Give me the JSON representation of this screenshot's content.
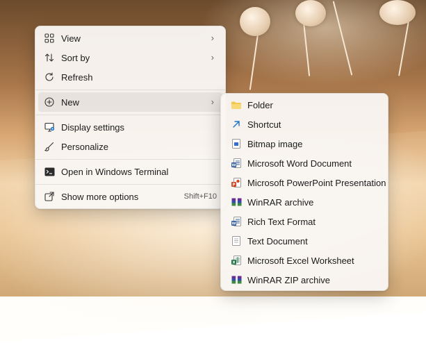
{
  "context_menu": {
    "items": [
      {
        "label": "View",
        "icon": "grid-view-icon"
      },
      {
        "label": "Sort by",
        "icon": "sort-icon"
      },
      {
        "label": "Refresh",
        "icon": "refresh-icon"
      },
      {
        "label": "New",
        "icon": "plus-circle-icon"
      },
      {
        "label": "Display settings",
        "icon": "display-settings-icon"
      },
      {
        "label": "Personalize",
        "icon": "brush-icon"
      },
      {
        "label": "Open in Windows Terminal",
        "icon": "terminal-icon"
      },
      {
        "label": "Show more options",
        "icon": "show-more-icon",
        "shortcut": "Shift+F10"
      }
    ],
    "submenu_chevron": "›"
  },
  "new_submenu": {
    "items": [
      {
        "label": "Folder",
        "icon": "folder-icon"
      },
      {
        "label": "Shortcut",
        "icon": "shortcut-arrow-icon"
      },
      {
        "label": "Bitmap image",
        "icon": "bitmap-icon"
      },
      {
        "label": "Microsoft Word Document",
        "icon": "word-icon"
      },
      {
        "label": "Microsoft PowerPoint Presentation",
        "icon": "powerpoint-icon"
      },
      {
        "label": "WinRAR archive",
        "icon": "winrar-icon"
      },
      {
        "label": "Rich Text Format",
        "icon": "rtf-icon"
      },
      {
        "label": "Text Document",
        "icon": "text-document-icon"
      },
      {
        "label": "Microsoft Excel Worksheet",
        "icon": "excel-icon"
      },
      {
        "label": "WinRAR ZIP archive",
        "icon": "winrar-zip-icon"
      }
    ]
  },
  "colors": {
    "folder": "#f2c94c",
    "word": "#2b579a",
    "powerpoint": "#d24726",
    "excel": "#217346",
    "winrar": "#6a2c91",
    "accent": "#1a73c8"
  }
}
